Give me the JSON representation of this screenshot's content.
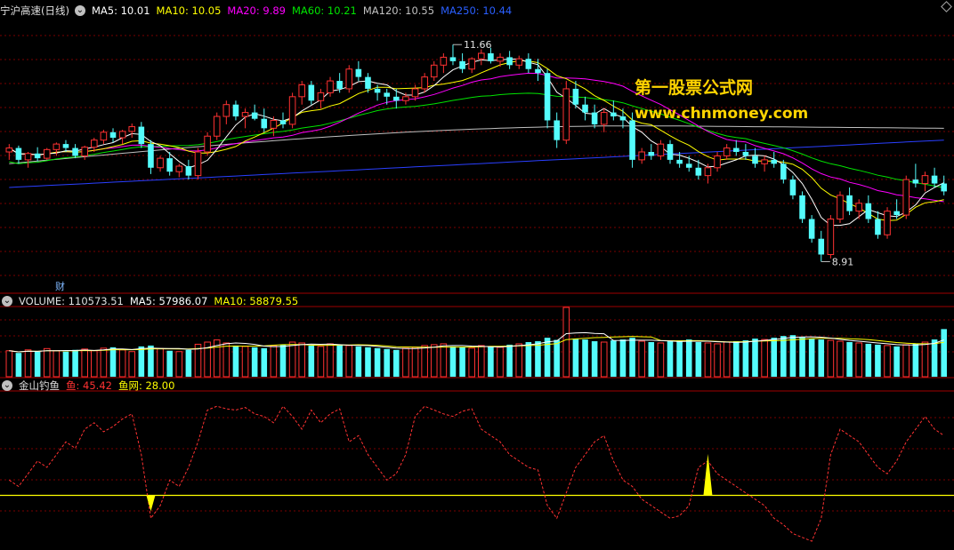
{
  "price_header": {
    "title": "宁沪高速(日线)",
    "ma5": "MA5: 10.01",
    "ma10": "MA10: 10.05",
    "ma20": "MA20: 9.89",
    "ma60": "MA60: 10.21",
    "ma120": "MA120: 10.55",
    "ma250": "MA250: 10.44"
  },
  "volume_header": {
    "volume": "VOLUME: 110573.51",
    "ma5": "MA5: 57986.07",
    "ma10": "MA10: 58879.55"
  },
  "indicator_header": {
    "name": "金山钓鱼",
    "fish": "鱼: 45.42",
    "net": "鱼网: 28.00"
  },
  "watermark": {
    "line1": "第一股票公式网",
    "line2": "www.chnmoney.com"
  },
  "annotations": {
    "high": "11.66",
    "low": "8.91",
    "cai": "财"
  },
  "colors": {
    "up": "#ff3232",
    "down": "#54fcfc",
    "ma5": "#ffffff",
    "ma10": "#ffff00",
    "ma20": "#ff00ff",
    "ma60": "#00e400",
    "ma120": "#c0c0c0",
    "ma250": "#2a3fff",
    "grid": "#7a0000",
    "fish": "#ff3232",
    "net": "#ffff00"
  },
  "chart_data": [
    {
      "type": "candlestick",
      "title": "宁沪高速(日线)",
      "y_range": [
        8.6,
        12.0
      ],
      "high_label": 11.66,
      "low_label": 8.91,
      "n_bars": 100,
      "ohlc": [
        [
          10.3,
          10.4,
          10.2,
          10.35
        ],
        [
          10.35,
          10.38,
          10.15,
          10.2
        ],
        [
          10.2,
          10.3,
          10.1,
          10.28
        ],
        [
          10.28,
          10.36,
          10.18,
          10.22
        ],
        [
          10.22,
          10.35,
          10.2,
          10.33
        ],
        [
          10.33,
          10.42,
          10.25,
          10.4
        ],
        [
          10.4,
          10.45,
          10.3,
          10.35
        ],
        [
          10.35,
          10.4,
          10.22,
          10.25
        ],
        [
          10.25,
          10.38,
          10.2,
          10.36
        ],
        [
          10.36,
          10.48,
          10.3,
          10.45
        ],
        [
          10.45,
          10.58,
          10.4,
          10.55
        ],
        [
          10.55,
          10.6,
          10.42,
          10.48
        ],
        [
          10.48,
          10.58,
          10.4,
          10.56
        ],
        [
          10.56,
          10.66,
          10.48,
          10.62
        ],
        [
          10.62,
          10.68,
          10.35,
          10.4
        ],
        [
          10.4,
          10.45,
          10.02,
          10.1
        ],
        [
          10.1,
          10.25,
          10.05,
          10.22
        ],
        [
          10.22,
          10.3,
          10.0,
          10.05
        ],
        [
          10.05,
          10.15,
          9.98,
          10.12
        ],
        [
          10.12,
          10.2,
          9.95,
          10.0
        ],
        [
          10.0,
          10.35,
          9.95,
          10.3
        ],
        [
          10.3,
          10.55,
          10.25,
          10.5
        ],
        [
          10.5,
          10.8,
          10.45,
          10.75
        ],
        [
          10.75,
          10.95,
          10.65,
          10.9
        ],
        [
          10.9,
          10.95,
          10.7,
          10.75
        ],
        [
          10.75,
          10.85,
          10.6,
          10.8
        ],
        [
          10.8,
          10.9,
          10.7,
          10.72
        ],
        [
          10.72,
          10.85,
          10.55,
          10.6
        ],
        [
          10.6,
          10.75,
          10.5,
          10.7
        ],
        [
          10.7,
          10.8,
          10.6,
          10.65
        ],
        [
          10.65,
          11.05,
          10.6,
          11.0
        ],
        [
          11.0,
          11.2,
          10.9,
          11.15
        ],
        [
          11.15,
          11.2,
          10.9,
          10.95
        ],
        [
          10.95,
          11.1,
          10.85,
          11.05
        ],
        [
          11.05,
          11.25,
          11.0,
          11.2
        ],
        [
          11.2,
          11.3,
          11.05,
          11.1
        ],
        [
          11.1,
          11.4,
          11.05,
          11.35
        ],
        [
          11.35,
          11.45,
          11.2,
          11.25
        ],
        [
          11.25,
          11.3,
          11.05,
          11.1
        ],
        [
          11.1,
          11.15,
          10.95,
          11.05
        ],
        [
          11.05,
          11.1,
          10.9,
          11.0
        ],
        [
          11.0,
          11.1,
          10.85,
          10.95
        ],
        [
          10.95,
          11.05,
          10.9,
          11.0
        ],
        [
          11.0,
          11.15,
          10.95,
          11.1
        ],
        [
          11.1,
          11.3,
          11.05,
          11.25
        ],
        [
          11.25,
          11.45,
          11.2,
          11.4
        ],
        [
          11.4,
          11.55,
          11.3,
          11.5
        ],
        [
          11.5,
          11.66,
          11.4,
          11.45
        ],
        [
          11.45,
          11.55,
          11.3,
          11.35
        ],
        [
          11.35,
          11.5,
          11.3,
          11.48
        ],
        [
          11.48,
          11.6,
          11.4,
          11.55
        ],
        [
          11.55,
          11.62,
          11.42,
          11.45
        ],
        [
          11.45,
          11.55,
          11.38,
          11.5
        ],
        [
          11.5,
          11.58,
          11.35,
          11.4
        ],
        [
          11.4,
          11.52,
          11.35,
          11.48
        ],
        [
          11.48,
          11.55,
          11.3,
          11.35
        ],
        [
          11.35,
          11.48,
          11.2,
          11.3
        ],
        [
          11.3,
          11.35,
          10.6,
          10.7
        ],
        [
          10.7,
          10.8,
          10.35,
          10.45
        ],
        [
          10.45,
          11.2,
          10.4,
          11.1
        ],
        [
          11.1,
          11.2,
          10.85,
          10.9
        ],
        [
          10.9,
          11.0,
          10.7,
          10.8
        ],
        [
          10.8,
          10.9,
          10.6,
          10.65
        ],
        [
          10.65,
          10.85,
          10.55,
          10.8
        ],
        [
          10.8,
          10.95,
          10.7,
          10.75
        ],
        [
          10.75,
          10.85,
          10.6,
          10.7
        ],
        [
          10.7,
          10.8,
          10.1,
          10.2
        ],
        [
          10.2,
          10.35,
          10.15,
          10.3
        ],
        [
          10.3,
          10.4,
          10.2,
          10.25
        ],
        [
          10.25,
          10.45,
          10.2,
          10.4
        ],
        [
          10.4,
          10.45,
          10.15,
          10.2
        ],
        [
          10.2,
          10.3,
          10.1,
          10.15
        ],
        [
          10.15,
          10.25,
          10.05,
          10.1
        ],
        [
          10.1,
          10.2,
          9.95,
          10.0
        ],
        [
          10.0,
          10.15,
          9.9,
          10.1
        ],
        [
          10.1,
          10.3,
          10.05,
          10.25
        ],
        [
          10.25,
          10.4,
          10.2,
          10.35
        ],
        [
          10.35,
          10.45,
          10.25,
          10.3
        ],
        [
          10.3,
          10.4,
          10.2,
          10.25
        ],
        [
          10.25,
          10.35,
          10.1,
          10.15
        ],
        [
          10.15,
          10.25,
          10.05,
          10.2
        ],
        [
          10.2,
          10.3,
          10.1,
          10.15
        ],
        [
          10.15,
          10.2,
          9.9,
          9.95
        ],
        [
          9.95,
          10.0,
          9.7,
          9.75
        ],
        [
          9.75,
          9.8,
          9.4,
          9.45
        ],
        [
          9.45,
          9.5,
          9.15,
          9.2
        ],
        [
          9.2,
          9.3,
          8.91,
          9.0
        ],
        [
          9.0,
          9.5,
          8.95,
          9.45
        ],
        [
          9.45,
          9.8,
          9.4,
          9.75
        ],
        [
          9.75,
          9.85,
          9.5,
          9.55
        ],
        [
          9.55,
          9.7,
          9.45,
          9.65
        ],
        [
          9.65,
          9.75,
          9.4,
          9.45
        ],
        [
          9.45,
          9.55,
          9.2,
          9.25
        ],
        [
          9.25,
          9.6,
          9.2,
          9.55
        ],
        [
          9.55,
          9.7,
          9.45,
          9.5
        ],
        [
          9.5,
          10.0,
          9.45,
          9.95
        ],
        [
          9.95,
          10.15,
          9.85,
          9.9
        ],
        [
          9.9,
          10.05,
          9.8,
          10.0
        ],
        [
          10.0,
          10.1,
          9.85,
          9.9
        ],
        [
          9.9,
          10.0,
          9.75,
          9.8
        ]
      ]
    },
    {
      "type": "bar",
      "title": "VOLUME",
      "y_range": [
        0,
        160000
      ],
      "volume_k": [
        60,
        55,
        62,
        58,
        65,
        60,
        58,
        62,
        64,
        60,
        66,
        68,
        62,
        58,
        70,
        72,
        65,
        60,
        58,
        62,
        75,
        80,
        85,
        78,
        72,
        70,
        68,
        66,
        72,
        74,
        80,
        78,
        72,
        70,
        76,
        74,
        72,
        70,
        68,
        66,
        64,
        62,
        66,
        68,
        72,
        74,
        76,
        70,
        68,
        66,
        72,
        70,
        68,
        74,
        76,
        80,
        82,
        90,
        85,
        160,
        88,
        86,
        82,
        80,
        84,
        86,
        90,
        82,
        80,
        78,
        82,
        84,
        86,
        80,
        78,
        76,
        80,
        82,
        84,
        88,
        86,
        90,
        94,
        96,
        92,
        88,
        86,
        84,
        82,
        80,
        78,
        76,
        74,
        72,
        70,
        74,
        76,
        80,
        86,
        110
      ]
    },
    {
      "type": "line",
      "title": "金山钓鱼",
      "y_range": [
        -10,
        110
      ],
      "fish": [
        40,
        35,
        45,
        55,
        50,
        60,
        70,
        65,
        80,
        85,
        78,
        82,
        88,
        92,
        60,
        10,
        20,
        40,
        35,
        50,
        70,
        95,
        98,
        96,
        95,
        97,
        92,
        90,
        85,
        98,
        90,
        80,
        95,
        85,
        92,
        96,
        70,
        75,
        60,
        50,
        40,
        45,
        60,
        90,
        98,
        95,
        92,
        90,
        94,
        96,
        80,
        75,
        70,
        60,
        55,
        50,
        48,
        20,
        10,
        30,
        50,
        60,
        70,
        75,
        55,
        40,
        35,
        25,
        20,
        15,
        10,
        12,
        20,
        50,
        55,
        45,
        40,
        35,
        30,
        25,
        20,
        10,
        5,
        -2,
        -5,
        -8,
        10,
        60,
        80,
        75,
        70,
        60,
        50,
        45,
        55,
        70,
        80,
        90,
        80,
        75
      ],
      "net_value": 28.0,
      "signal_bars": [
        15,
        74
      ]
    }
  ]
}
